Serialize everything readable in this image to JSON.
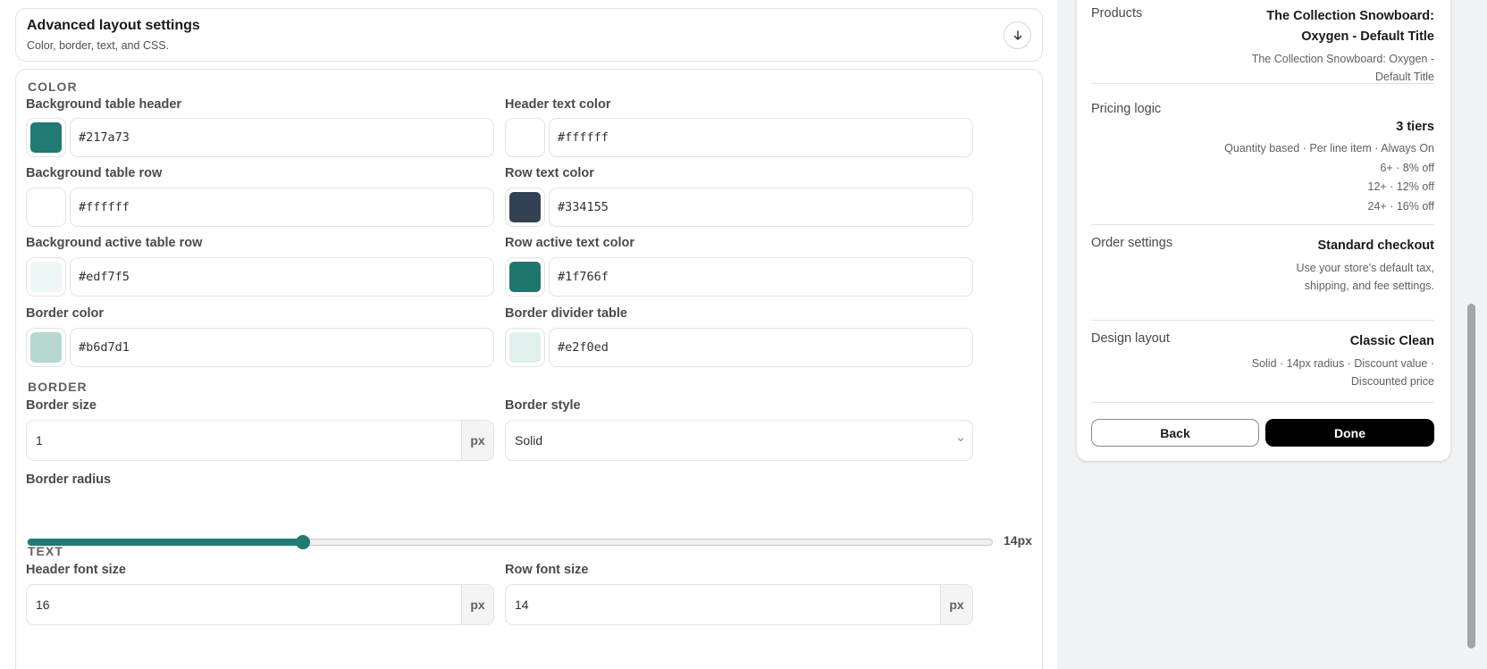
{
  "advanced": {
    "title": "Advanced layout settings",
    "subtitle": "Color, border, text, and CSS.",
    "toggle_icon": "arrow-down-icon"
  },
  "color": {
    "section": "COLOR",
    "fields": [
      {
        "label": "Background table header",
        "value": "#217a73",
        "swatch": "#217a73"
      },
      {
        "label": "Header text color",
        "value": "#ffffff",
        "swatch": "#ffffff"
      },
      {
        "label": "Background table row",
        "value": "#ffffff",
        "swatch": "#ffffff"
      },
      {
        "label": "Row text color",
        "value": "#334155",
        "swatch": "#334155"
      },
      {
        "label": "Background active table row",
        "value": "#edf7f5",
        "swatch": "#edf7f5"
      },
      {
        "label": "Row active text color",
        "value": "#1f766f",
        "swatch": "#1f766f"
      },
      {
        "label": "Border color",
        "value": "#b6d7d1",
        "swatch": "#b6d7d1"
      },
      {
        "label": "Border divider table",
        "value": "#e2f0ed",
        "swatch": "#e2f0ed"
      }
    ]
  },
  "border": {
    "section": "BORDER",
    "size_label": "Border size",
    "size_value": "1",
    "size_unit": "px",
    "style_label": "Border style",
    "style_value": "Solid",
    "radius_label": "Border radius",
    "radius_value": "14px",
    "radius_fraction": 0.285,
    "accent": "#217a73"
  },
  "text": {
    "section": "TEXT",
    "header_label": "Header font size",
    "header_value": "16",
    "header_unit": "px",
    "row_label": "Row font size",
    "row_value": "14",
    "row_unit": "px"
  },
  "summary": {
    "products_label": "Products",
    "products_value": "The Collection Snowboard: Oxygen - Default Title",
    "products_detail": "The Collection Snowboard: Oxygen - Default Title",
    "pricing_label": "Pricing logic",
    "pricing_value": "3 tiers",
    "pricing_detail": "Quantity based · Per line item · Always On",
    "tiers": [
      "6+ · 8% off",
      "12+ · 12% off",
      "24+ · 16% off"
    ],
    "order_label": "Order settings",
    "order_value": "Standard checkout",
    "order_detail": "Use your store's default tax, shipping, and fee settings.",
    "design_label": "Design layout",
    "design_value": "Classic Clean",
    "design_detail": "Solid · 14px radius · Discount value · Discounted price",
    "back_label": "Back",
    "done_label": "Done"
  }
}
